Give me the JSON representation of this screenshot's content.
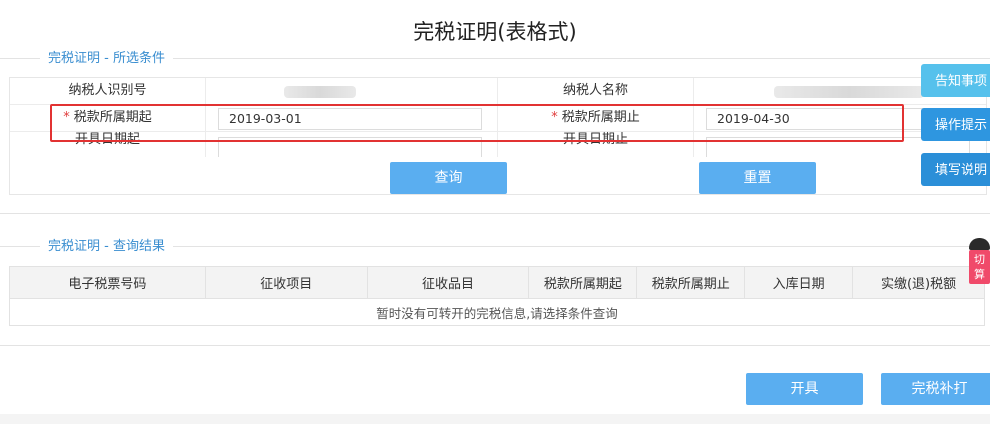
{
  "page": {
    "title": "完税证明(表格式)"
  },
  "conditions": {
    "legend": "完税证明 - 所选条件",
    "taxpayer_id_label": "纳税人识别号",
    "taxpayer_name_label": "纳税人名称",
    "required_mark": "*",
    "period_start_label": "税款所属期起",
    "period_start_value": "2019-03-01",
    "period_end_label": "税款所属期止",
    "period_end_value": "2019-04-30",
    "issue_start_label": "开具日期起",
    "issue_end_label": "开具日期止",
    "query_button": "查询",
    "reset_button": "重置"
  },
  "side_panel": {
    "notice": "告知事项",
    "guide": "操作提示",
    "fill": "填写说明"
  },
  "results": {
    "legend": "完税证明 - 查询结果",
    "columns": [
      "电子税票号码",
      "征收项目",
      "征收品目",
      "税款所属期起",
      "税款所属期止",
      "入库日期",
      "实缴(退)税额"
    ],
    "empty_message": "暂时没有可转开的完税信息,请选择条件查询"
  },
  "mascot": {
    "text": "切算"
  },
  "actions": {
    "issue_button": "开具",
    "reprint_button": "完税补打"
  },
  "colors": {
    "primary_button": "#5aaef0",
    "legend_text": "#3a8ed0",
    "highlight_frame": "#e23232",
    "side_button": "#3399dd"
  }
}
